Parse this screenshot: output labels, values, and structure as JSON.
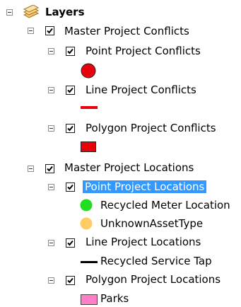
{
  "toc": {
    "root": {
      "label": "Layers",
      "icon": "layers-icon"
    },
    "master_conflicts": {
      "label": "Master Project Conflicts",
      "checked": true,
      "layers": [
        {
          "label": "Point Project Conflicts",
          "checked": true,
          "symbol": "circle",
          "color": "#e8000d"
        },
        {
          "label": "Line Project Conflicts",
          "checked": true,
          "symbol": "line",
          "color": "#e8000d"
        },
        {
          "label": "Polygon Project Conflicts",
          "checked": true,
          "symbol": "rect",
          "color": "#e8000d"
        }
      ]
    },
    "master_locations": {
      "label": "Master Project Locations",
      "checked": true,
      "layers": [
        {
          "label": "Point Project Locations",
          "checked": true,
          "selected": true,
          "classes": [
            {
              "label": "Recycled Meter Location",
              "symbol": "circle",
              "color": "#22dd22"
            },
            {
              "label": "UnknownAssetType",
              "symbol": "circle",
              "color": "#ffcc66"
            }
          ]
        },
        {
          "label": "Line Project Locations",
          "checked": true,
          "classes": [
            {
              "label": "Recycled Service Tap",
              "symbol": "line",
              "color": "#000000"
            }
          ]
        },
        {
          "label": "Polygon Project Locations",
          "checked": true,
          "classes": [
            {
              "label": "Parks",
              "symbol": "rect",
              "color": "#ff80c8"
            }
          ]
        }
      ]
    }
  }
}
